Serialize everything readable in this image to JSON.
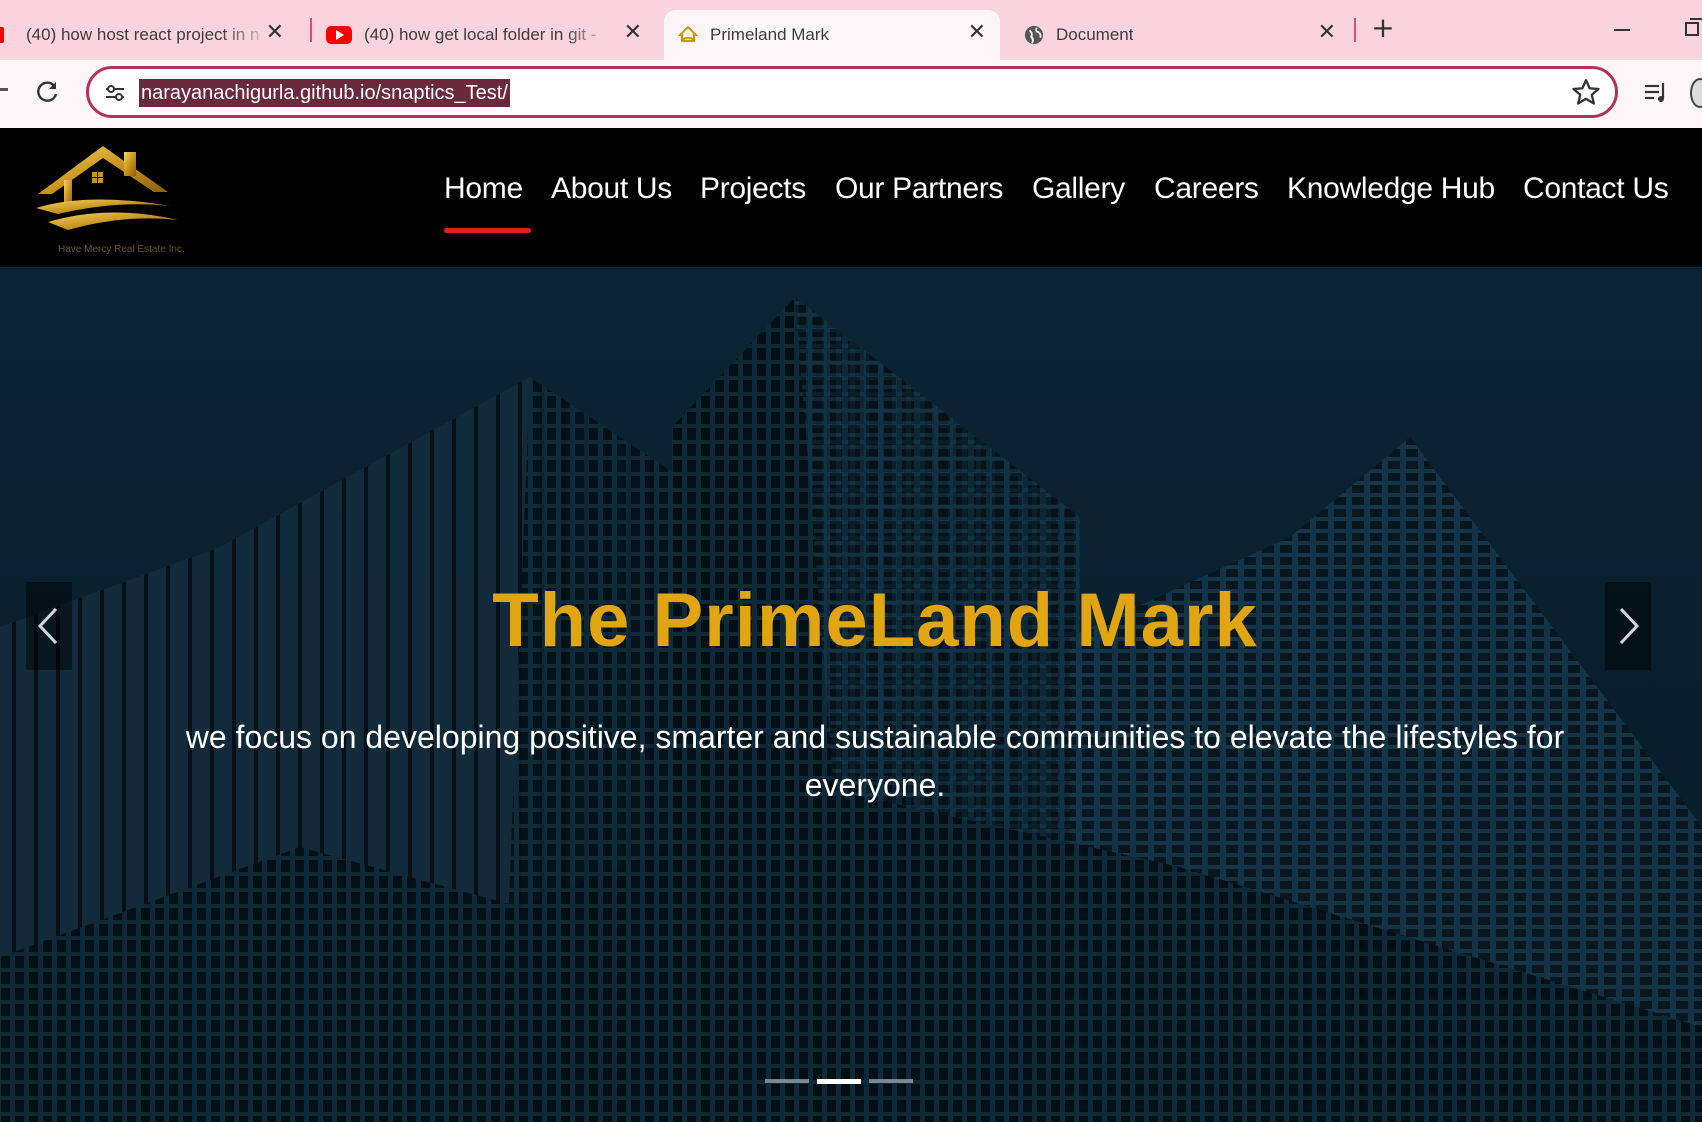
{
  "browser": {
    "tabs": [
      {
        "title": "(40) how host react project in n",
        "favicon": "youtube-icon",
        "active": false
      },
      {
        "title": "(40) how get local folder in git -",
        "favicon": "youtube-icon",
        "active": false
      },
      {
        "title": "Primeland Mark",
        "favicon": "site-logo-icon",
        "active": true
      },
      {
        "title": "Document",
        "favicon": "globe-icon",
        "active": false
      }
    ],
    "new_tab_label": "+",
    "url": "narayanachigurla.github.io/snaptics_Test/",
    "colors": {
      "tabstrip": "#f9d4de",
      "toolbar": "#fdf6f8",
      "omnibox_border": "#b0345a",
      "url_highlight": "#6b2a3c"
    }
  },
  "site": {
    "logo_caption": "Have Mercy Real Estate Inc.",
    "nav": [
      "Home",
      "About Us",
      "Projects",
      "Our Partners",
      "Gallery",
      "Careers",
      "Knowledge Hub",
      "Contact Us"
    ],
    "active_nav": "Home",
    "hero": {
      "title": "The PrimeLand Mark",
      "subtitle": "we focus on developing positive, smarter and sustainable communities to elevate the lifestyles for everyone.",
      "slide_count": 3,
      "active_slide": 2
    },
    "colors": {
      "accent_gold": "#e0a511",
      "active_underline": "#e01e25",
      "header_bg": "#000000"
    }
  }
}
